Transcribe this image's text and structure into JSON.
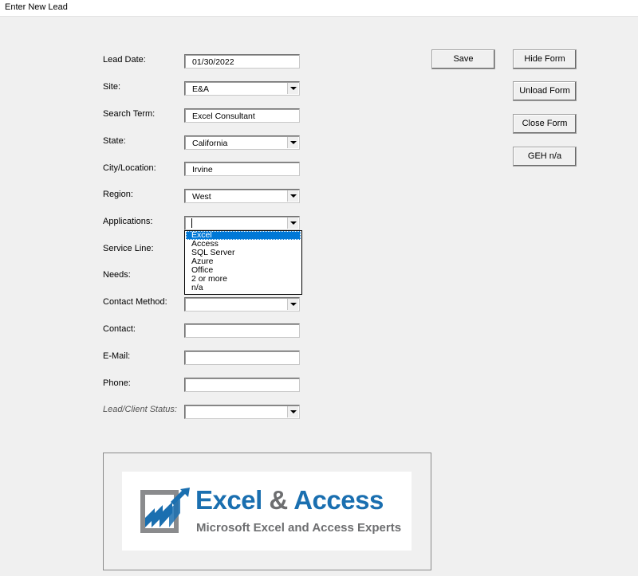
{
  "window": {
    "title": "Enter New Lead"
  },
  "form": {
    "fields": [
      {
        "label": "Lead Date:",
        "value": "01/30/2022",
        "type": "text"
      },
      {
        "label": "Site:",
        "value": "E&A",
        "type": "combo"
      },
      {
        "label": "Search Term:",
        "value": "Excel Consultant",
        "type": "text"
      },
      {
        "label": "State:",
        "value": "California",
        "type": "combo"
      },
      {
        "label": "City/Location:",
        "value": "Irvine",
        "type": "text"
      },
      {
        "label": "Region:",
        "value": "West",
        "type": "combo"
      },
      {
        "label": "Applications:",
        "value": "",
        "type": "combo"
      },
      {
        "label": "Service Line:",
        "value": "",
        "type": "combo"
      },
      {
        "label": "Needs:",
        "value": "",
        "type": "text"
      },
      {
        "label": "Contact Method:",
        "value": "",
        "type": "combo"
      },
      {
        "label": "Contact:",
        "value": "",
        "type": "text"
      },
      {
        "label": "E-Mail:",
        "value": "",
        "type": "text"
      },
      {
        "label": "Phone:",
        "value": "",
        "type": "text"
      },
      {
        "label": "Lead/Client Status:",
        "value": "",
        "type": "combo"
      }
    ]
  },
  "applications_dropdown": {
    "options": [
      "Excel",
      "Access",
      "SQL Server",
      "Azure",
      "Office",
      "2 or more",
      "n/a"
    ],
    "selected": "Excel"
  },
  "buttons": {
    "save": "Save",
    "hide_form": "Hide Form",
    "unload_form": "Unload Form",
    "close_form": "Close Form",
    "geh": "GEH n/a"
  },
  "logo": {
    "brand_part1": "Excel",
    "brand_amp": "&",
    "brand_part2": "Access",
    "tagline": "Microsoft Excel and Access Experts",
    "colors": {
      "blue": "#1a6fb0",
      "gray": "#6d6e70"
    }
  }
}
